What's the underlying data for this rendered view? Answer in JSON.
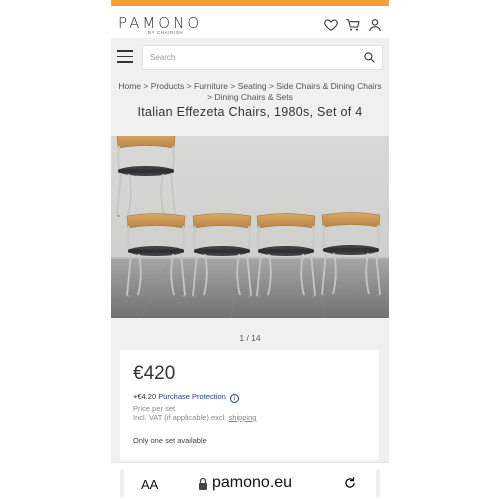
{
  "brand": {
    "logo": "PAMONO",
    "tagline": "BY CHAIRISH"
  },
  "header_icons": [
    "heart-icon",
    "cart-icon",
    "user-icon"
  ],
  "search": {
    "placeholder": "Search"
  },
  "breadcrumb": {
    "items": [
      "Home",
      "Products",
      "Furniture",
      "Seating",
      "Side Chairs & Dining Chairs",
      "Dining Chairs & Sets"
    ],
    "separator": ">"
  },
  "product": {
    "title": "Italian Effezeta Chairs, 1980s, Set of 4",
    "gallery_position": "1 / 14",
    "price": "€420",
    "protection_amount": "+€4.20",
    "protection_label": "Purchase Protection",
    "price_note": "Price per set",
    "vat_note": "Incl. VAT (if applicable) excl.",
    "shipping_link": "shipping",
    "availability": "Only one set available"
  },
  "browser": {
    "text_size_label": "AA",
    "url": "pamono.eu"
  },
  "colors": {
    "accent_bar": "#f7a035",
    "link": "#1a3d9a"
  }
}
